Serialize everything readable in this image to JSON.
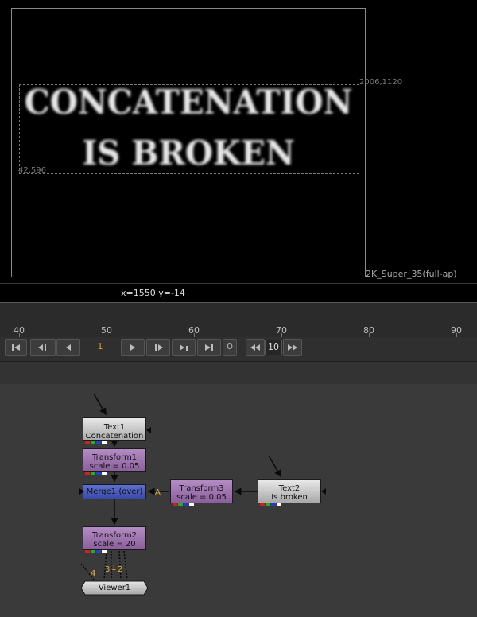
{
  "viewer": {
    "line1": "CONCATENATION",
    "line2": "IS BROKEN",
    "bbox_top_right": "2006,1120",
    "bbox_bottom_left": "42,596",
    "format_label": "2K_Super_35(full-ap)"
  },
  "info": {
    "coords": "x=1550 y=-14"
  },
  "timeline": {
    "ticks": [
      "40",
      "50",
      "60",
      "70",
      "80",
      "90"
    ]
  },
  "transport": {
    "frame": "1",
    "increment": "10",
    "in_out_label": "O"
  },
  "nodes": {
    "text1": {
      "title": "Text1",
      "sub": "Concatenation"
    },
    "transform1": {
      "title": "Transform1",
      "sub": "scale = 0.05"
    },
    "merge1": {
      "title": "Merge1 (over)"
    },
    "transform3": {
      "title": "Transform3",
      "sub": "scale = 0.05"
    },
    "text2": {
      "title": "Text2",
      "sub": "Is broken"
    },
    "transform2": {
      "title": "Transform2",
      "sub": "scale = 20"
    },
    "viewer1": {
      "title": "Viewer1"
    },
    "merge_input_a": "A",
    "viewer_inputs": {
      "four": "4",
      "three": "3",
      "one": "1",
      "two": "2"
    }
  },
  "colors": {
    "frame_number": "#e59a2c",
    "node_gray": "#c8c8c8",
    "node_purple": "#a07ab2",
    "node_merge": "#4a5cc0",
    "graph_bg": "#3a3a3a"
  }
}
